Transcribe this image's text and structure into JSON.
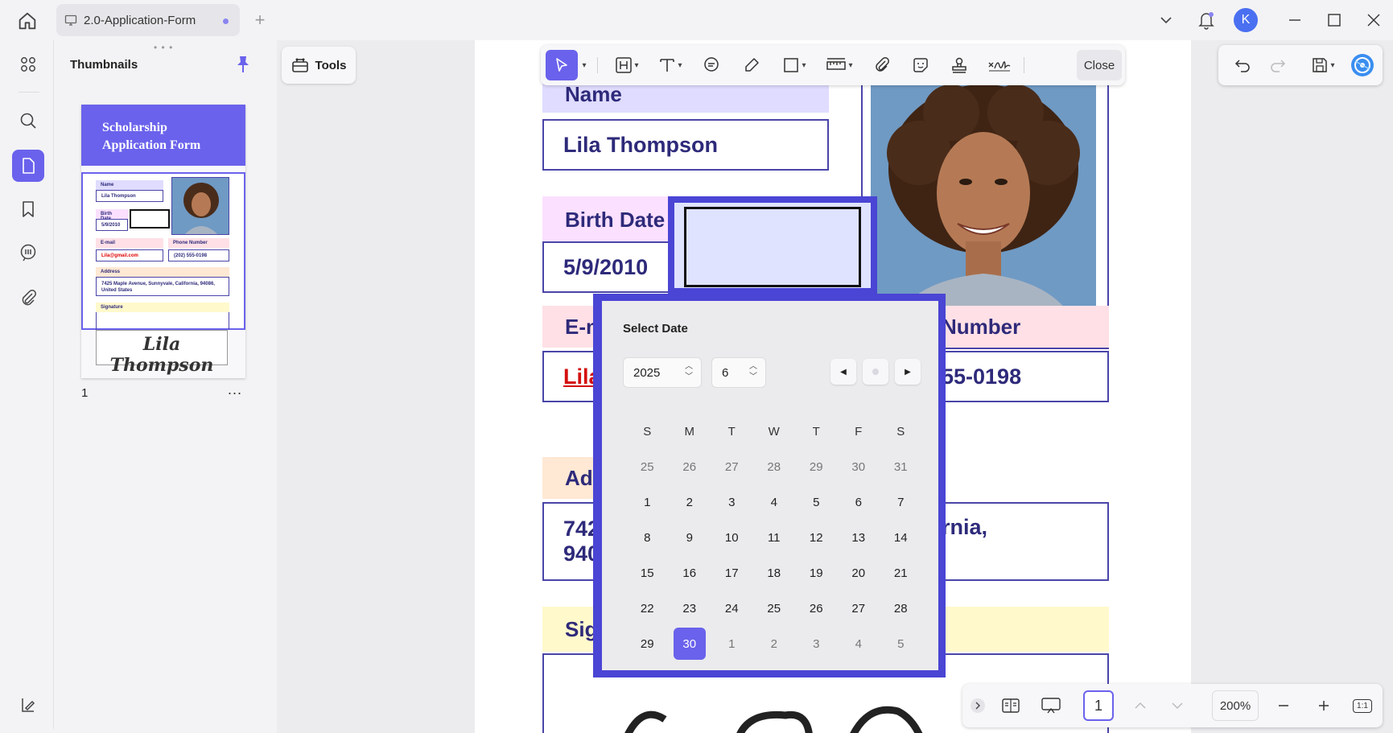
{
  "titlebar": {
    "tab_title": "2.0-Application-Form",
    "new_tab": "+",
    "avatar_letter": "K"
  },
  "thumbnails": {
    "title": "Thumbnails",
    "page_number": "1",
    "more": "...",
    "thumb_header": "Scholarship Application Form",
    "thumb_labels": [
      "Name",
      "Lila Thompson",
      "Birth Date",
      "5/9/2010",
      "E-mail",
      "Phone Number",
      "Lila@gmail.com",
      "(202) 555-0198",
      "Address",
      "7425 Maple Avenue, Sunnyvale, California, 94086, United States",
      "Signature"
    ],
    "thumb_signature": "Lila Thompson"
  },
  "tools": {
    "label": "Tools"
  },
  "toolbar": {
    "close_label": "Close"
  },
  "form": {
    "name_label": "Name",
    "name_value": "Lila Thompson",
    "birth_label": "Birth Date",
    "birth_value": "5/9/2010",
    "email_label_partial": "E-m",
    "email_value_partial": "Lila",
    "phone_label_partial": "Number",
    "phone_value_partial": "55-0198",
    "address_label_partial": "Ad",
    "address_line1_partial": "742",
    "address_line1_right": "rnia,",
    "address_line2_partial": "940",
    "signature_label_partial": "Sig"
  },
  "date_picker": {
    "title": "Select Date",
    "year": "2025",
    "month": "6",
    "weekdays": [
      "S",
      "M",
      "T",
      "W",
      "T",
      "F",
      "S"
    ],
    "weeks": [
      [
        {
          "d": "25",
          "m": true
        },
        {
          "d": "26",
          "m": true
        },
        {
          "d": "27",
          "m": true
        },
        {
          "d": "28",
          "m": true
        },
        {
          "d": "29",
          "m": true
        },
        {
          "d": "30",
          "m": true
        },
        {
          "d": "31",
          "m": true
        }
      ],
      [
        {
          "d": "1"
        },
        {
          "d": "2"
        },
        {
          "d": "3"
        },
        {
          "d": "4"
        },
        {
          "d": "5"
        },
        {
          "d": "6"
        },
        {
          "d": "7"
        }
      ],
      [
        {
          "d": "8"
        },
        {
          "d": "9"
        },
        {
          "d": "10"
        },
        {
          "d": "11"
        },
        {
          "d": "12"
        },
        {
          "d": "13"
        },
        {
          "d": "14"
        }
      ],
      [
        {
          "d": "15"
        },
        {
          "d": "16"
        },
        {
          "d": "17"
        },
        {
          "d": "18"
        },
        {
          "d": "19"
        },
        {
          "d": "20"
        },
        {
          "d": "21"
        }
      ],
      [
        {
          "d": "22"
        },
        {
          "d": "23"
        },
        {
          "d": "24"
        },
        {
          "d": "25"
        },
        {
          "d": "26"
        },
        {
          "d": "27"
        },
        {
          "d": "28"
        }
      ],
      [
        {
          "d": "29"
        },
        {
          "d": "30",
          "sel": true
        },
        {
          "d": "1",
          "m": true
        },
        {
          "d": "2",
          "m": true
        },
        {
          "d": "3",
          "m": true
        },
        {
          "d": "4",
          "m": true
        },
        {
          "d": "5",
          "m": true
        }
      ]
    ]
  },
  "bottom_nav": {
    "page_input": "1",
    "zoom": "200%",
    "fit_label": "1:1"
  },
  "colors": {
    "accent": "#6a62ec",
    "form_text": "#2e2a7a",
    "picker_border": "#4a45d4",
    "name_label_bg": "#dfdcff",
    "birth_label_bg": "#fbe0ff",
    "email_label_bg": "#ffe0e6",
    "address_label_bg": "#ffe8d4",
    "signature_label_bg": "#fff9cc"
  }
}
